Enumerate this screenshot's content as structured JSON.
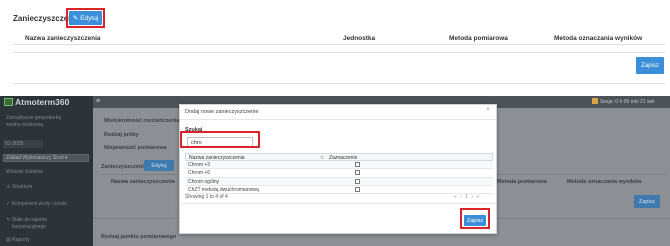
{
  "top_section": {
    "title": "Zanieczyszczenia",
    "edit_button": "Edytuj",
    "columns": [
      "Nazwa zanieczyszczenia",
      "Jednostka",
      "Metoda pomiarowa",
      "Metoda oznaczania wyników"
    ],
    "save_button": "Zapisz"
  },
  "app": {
    "logo": "Atmoterm360",
    "session": "Sesja: 0 h 09 min 21 sek",
    "sidebar": {
      "header_line1": "Zarządzanie gospodarką",
      "header_line2": "wodno-ściekową",
      "date": "01-2025",
      "select_value": "Zakład Wykonawczy Środ ▾",
      "section": "Wnioski ścieków",
      "items": [
        "Struktura",
        "Komponent wody i ścieki",
        "Stałe do raportu",
        "korporacyjnego",
        "Raporty"
      ]
    },
    "background": {
      "labels": [
        "Wielokrotność rozcieńczenia",
        "Rodzaj próby",
        "Niepewność pomiarowa",
        "Zanieczyszczenia",
        "Nazwa zanieczyszczenia",
        "Rodzaj punktu pomiarowego"
      ],
      "edit_button": "Edytuj",
      "col_method_measure": "Metoda pomiarowa",
      "col_method_results": "Metoda oznaczania wyników",
      "save_button": "Zapisz"
    }
  },
  "modal": {
    "title": "Dodaj nowe zanieczyszczenie",
    "close": "×",
    "search_label": "Szukaj",
    "search_value": "chro",
    "columns": [
      "Nazwa zanieczyszczenia",
      "Zaznaczenie"
    ],
    "sort_icon": "sort-icon",
    "rows": [
      {
        "name": "Chrom +3"
      },
      {
        "name": "Chrom +6"
      },
      {
        "name": "Chrom ogólny"
      },
      {
        "name": "ChZT metodą dwuchromianową"
      }
    ],
    "footer": "Showing 1 to 4 of 4",
    "pager": "«  ‹  1  ›  »",
    "save_button": "Zapisz"
  },
  "colors": {
    "accent": "#3b8fd9",
    "highlight": "#d9252a",
    "sidebar": "#2d3438"
  }
}
